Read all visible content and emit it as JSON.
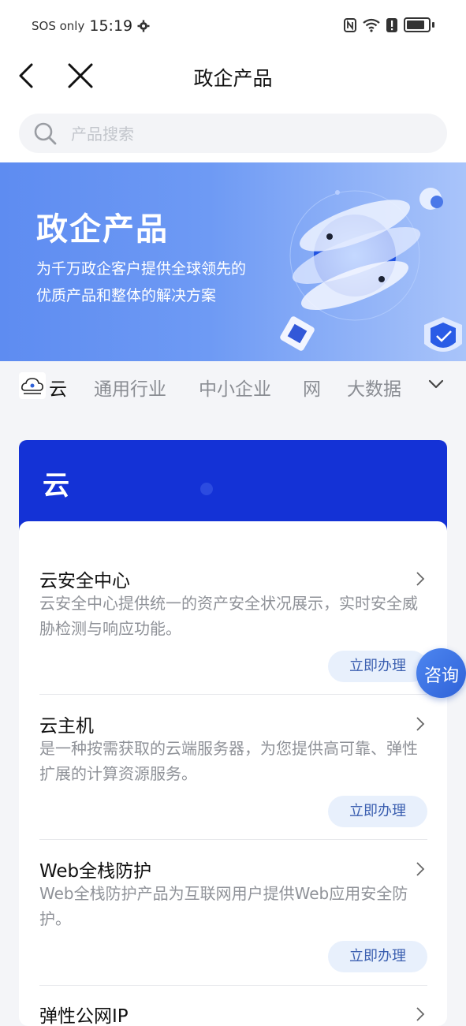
{
  "status_bar": {
    "carrier": "SOS only",
    "time": "15:19"
  },
  "nav": {
    "title": "政企产品"
  },
  "search": {
    "placeholder": "产品搜索"
  },
  "banner": {
    "title": "政企产品",
    "subtitle_line1": "为千万政企客户提供全球领先的",
    "subtitle_line2": "优质产品和整体的解决方案"
  },
  "tabs": [
    {
      "label": "云",
      "active": true
    },
    {
      "label": "通用行业",
      "active": false
    },
    {
      "label": "中小企业",
      "active": false
    },
    {
      "label": "网",
      "active": false
    },
    {
      "label": "大数据",
      "active": false
    }
  ],
  "category": {
    "title": "云"
  },
  "products": [
    {
      "name": "云安全中心",
      "desc": "云安全中心提供统一的资产安全状况展示，实时安全威胁检测与响应功能。",
      "action": "立即办理"
    },
    {
      "name": "云主机",
      "desc": "是一种按需获取的云端服务器，为您提供高可靠、弹性扩展的计算资源服务。",
      "action": "立即办理"
    },
    {
      "name": "Web全栈防护",
      "desc": "Web全栈防护产品为互联网用户提供Web应用安全防护。",
      "action": "立即办理"
    },
    {
      "name": "弹性公网IP",
      "desc": "",
      "action": ""
    }
  ],
  "floating": {
    "consult_label": "咨询"
  },
  "colors": {
    "brand_blue": "#1432d6",
    "banner_blue": "#6e9af4",
    "button_bg": "#e8f0fc"
  }
}
